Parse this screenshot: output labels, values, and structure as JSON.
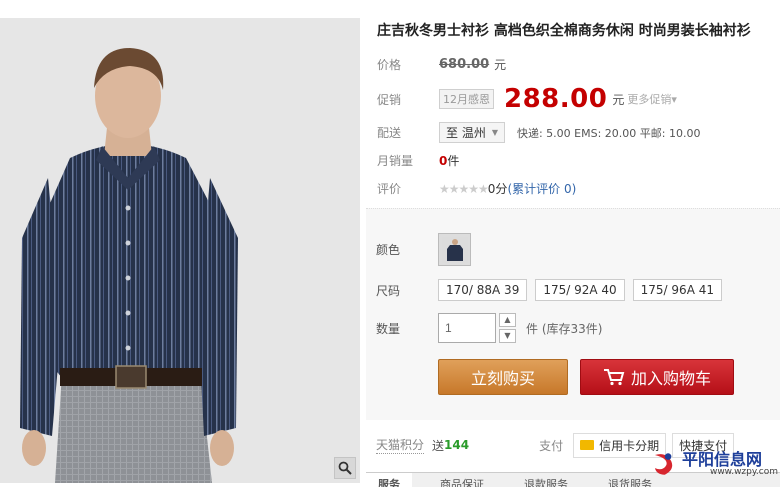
{
  "product": {
    "title": "庄吉秋冬男士衬衫 高档色织全棉商务休闲 时尚男装长袖衬衫"
  },
  "price": {
    "label": "价格",
    "original": "680.00",
    "unit": "元"
  },
  "promo": {
    "label": "促销",
    "tag": "12月感恩",
    "price": "288.00",
    "unit": "元",
    "more": "更多促销▾"
  },
  "shipping": {
    "label": "配送",
    "destination": "至 温州",
    "detail": "快递: 5.00 EMS: 20.00 平邮: 10.00"
  },
  "sales": {
    "label": "月销量",
    "count": "0",
    "unit": "件"
  },
  "rating": {
    "label": "评价",
    "stars": "★★★★★",
    "score": "0分",
    "reviews_prefix": "(累计评价 ",
    "reviews_count": "0",
    "reviews_suffix": ")"
  },
  "options": {
    "color_label": "颜色",
    "size_label": "尺码",
    "sizes": [
      "170/ 88A 39",
      "175/ 92A 40",
      "175/ 96A 41"
    ],
    "qty_label": "数量",
    "qty_value": "1",
    "stock": "件 (库存33件)"
  },
  "buttons": {
    "buy_now": "立刻购买",
    "add_cart": "加入购物车"
  },
  "points": {
    "label": "天猫积分",
    "sent": "送",
    "value": "144"
  },
  "payment": {
    "label": "支付",
    "credit": "信用卡分期",
    "quick": "快捷支付"
  },
  "tabs": [
    "服务",
    "商品保证",
    "退款服务",
    "退货服务"
  ],
  "watermark": {
    "cn": "平阳信息网",
    "en": "www.wzpy.com"
  },
  "colors": {
    "price_red": "#c40000",
    "buy_orange": "#c7782a",
    "cart_red": "#b50f18",
    "points_green": "#2a9b2a"
  }
}
